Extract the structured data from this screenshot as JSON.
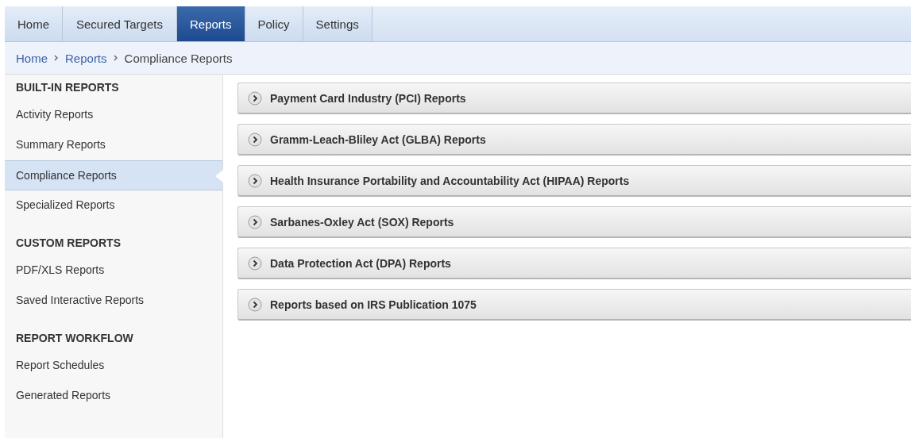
{
  "tabs": [
    {
      "label": "Home",
      "selected": false
    },
    {
      "label": "Secured Targets",
      "selected": false
    },
    {
      "label": "Reports",
      "selected": true
    },
    {
      "label": "Policy",
      "selected": false
    },
    {
      "label": "Settings",
      "selected": false
    }
  ],
  "breadcrumb": [
    {
      "label": "Home",
      "kind": "link"
    },
    {
      "label": "Reports",
      "kind": "link"
    },
    {
      "label": "Compliance Reports",
      "kind": "current"
    }
  ],
  "sidebar": {
    "sections": [
      {
        "heading": "BUILT-IN REPORTS",
        "items": [
          {
            "label": "Activity Reports",
            "selected": false
          },
          {
            "label": "Summary Reports",
            "selected": false
          },
          {
            "label": "Compliance Reports",
            "selected": true
          },
          {
            "label": "Specialized Reports",
            "selected": false
          }
        ]
      },
      {
        "heading": "CUSTOM REPORTS",
        "items": [
          {
            "label": "PDF/XLS Reports",
            "selected": false
          },
          {
            "label": "Saved Interactive Reports",
            "selected": false
          }
        ]
      },
      {
        "heading": "REPORT WORKFLOW",
        "items": [
          {
            "label": "Report Schedules",
            "selected": false
          },
          {
            "label": "Generated Reports",
            "selected": false
          }
        ]
      }
    ]
  },
  "panels": [
    {
      "title": "Payment Card Industry (PCI) Reports",
      "expanded": false
    },
    {
      "title": "Gramm-Leach-Bliley Act (GLBA) Reports",
      "expanded": false
    },
    {
      "title": "Health Insurance Portability and Accountability Act (HIPAA) Reports",
      "expanded": false
    },
    {
      "title": "Sarbanes-Oxley Act (SOX) Reports",
      "expanded": false
    },
    {
      "title": "Data Protection Act (DPA) Reports",
      "expanded": false
    },
    {
      "title": "Reports based on IRS Publication 1075",
      "expanded": false
    }
  ]
}
